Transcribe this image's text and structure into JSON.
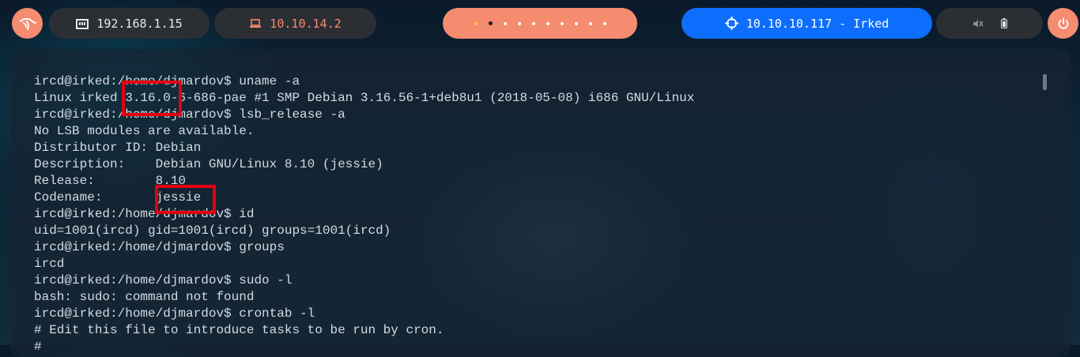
{
  "topbar": {
    "local_ip": "192.168.1.15",
    "vpn_ip": "10.10.14.2",
    "target": "10.10.10.117 - Irked",
    "workspaces_count": 10,
    "active_workspace": 2,
    "colors": {
      "accent": "#f58b6f",
      "target": "#0d6efd",
      "pill_bg": "#2b2f33"
    },
    "icons": [
      "kali-dragon-icon",
      "ethernet-icon",
      "laptop-icon",
      "crosshair-icon",
      "mute-icon",
      "battery-icon",
      "power-icon"
    ]
  },
  "terminal": {
    "lines": [
      "ircd@irked:/home/djmardov$ uname -a",
      "Linux irked 3.16.0-6-686-pae #1 SMP Debian 3.16.56-1+deb8u1 (2018-05-08) i686 GNU/Linux",
      "ircd@irked:/home/djmardov$ lsb_release -a",
      "No LSB modules are available.",
      "Distributor ID: Debian",
      "Description:    Debian GNU/Linux 8.10 (jessie)",
      "Release:        8.10",
      "Codename:       jessie",
      "ircd@irked:/home/djmardov$ id",
      "uid=1001(ircd) gid=1001(ircd) groups=1001(ircd)",
      "ircd@irked:/home/djmardov$ groups",
      "ircd",
      "ircd@irked:/home/djmardov$ sudo -l",
      "bash: sudo: command not found",
      "ircd@irked:/home/djmardov$ crontab -l",
      "# Edit this file to introduce tasks to be run by cron.",
      "#"
    ],
    "highlights": [
      "3.16.0",
      "jessie"
    ]
  }
}
